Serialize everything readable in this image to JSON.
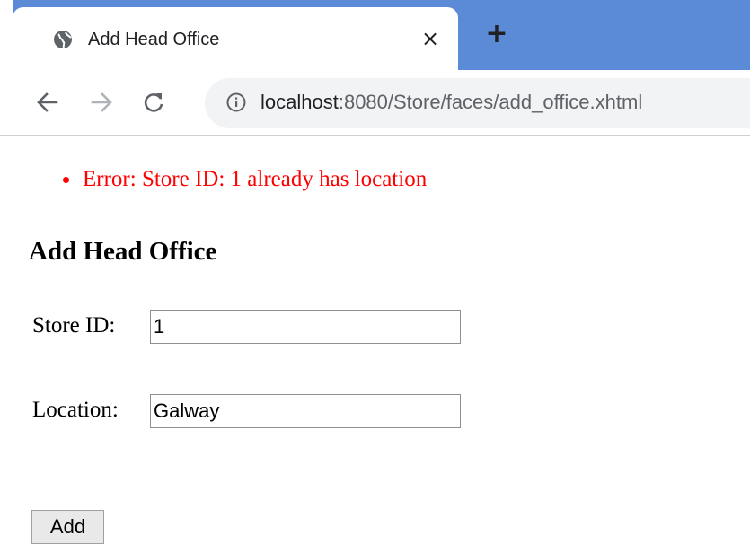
{
  "browser": {
    "tab": {
      "title": "Add Head Office",
      "close_glyph": "×",
      "icon": "globe-icon"
    },
    "new_tab_glyph": "+",
    "nav": {
      "back_icon": "arrow-left-icon",
      "forward_icon": "arrow-right-icon",
      "reload_icon": "reload-icon"
    },
    "address": {
      "host": "localhost",
      "path": ":8080/Store/faces/add_office.xhtml",
      "icon": "info-icon"
    },
    "colors": {
      "tabstrip": "#5b8ad7",
      "omnibox": "#f1f3f4"
    }
  },
  "page": {
    "errors": [
      "Error: Store ID: 1 already has location"
    ],
    "error_color": "#ff0000",
    "title": "Add Head Office",
    "form": {
      "store_id": {
        "label": "Store ID:",
        "value": "1"
      },
      "location": {
        "label": "Location:",
        "value": "Galway"
      },
      "submit_label": "Add"
    }
  }
}
